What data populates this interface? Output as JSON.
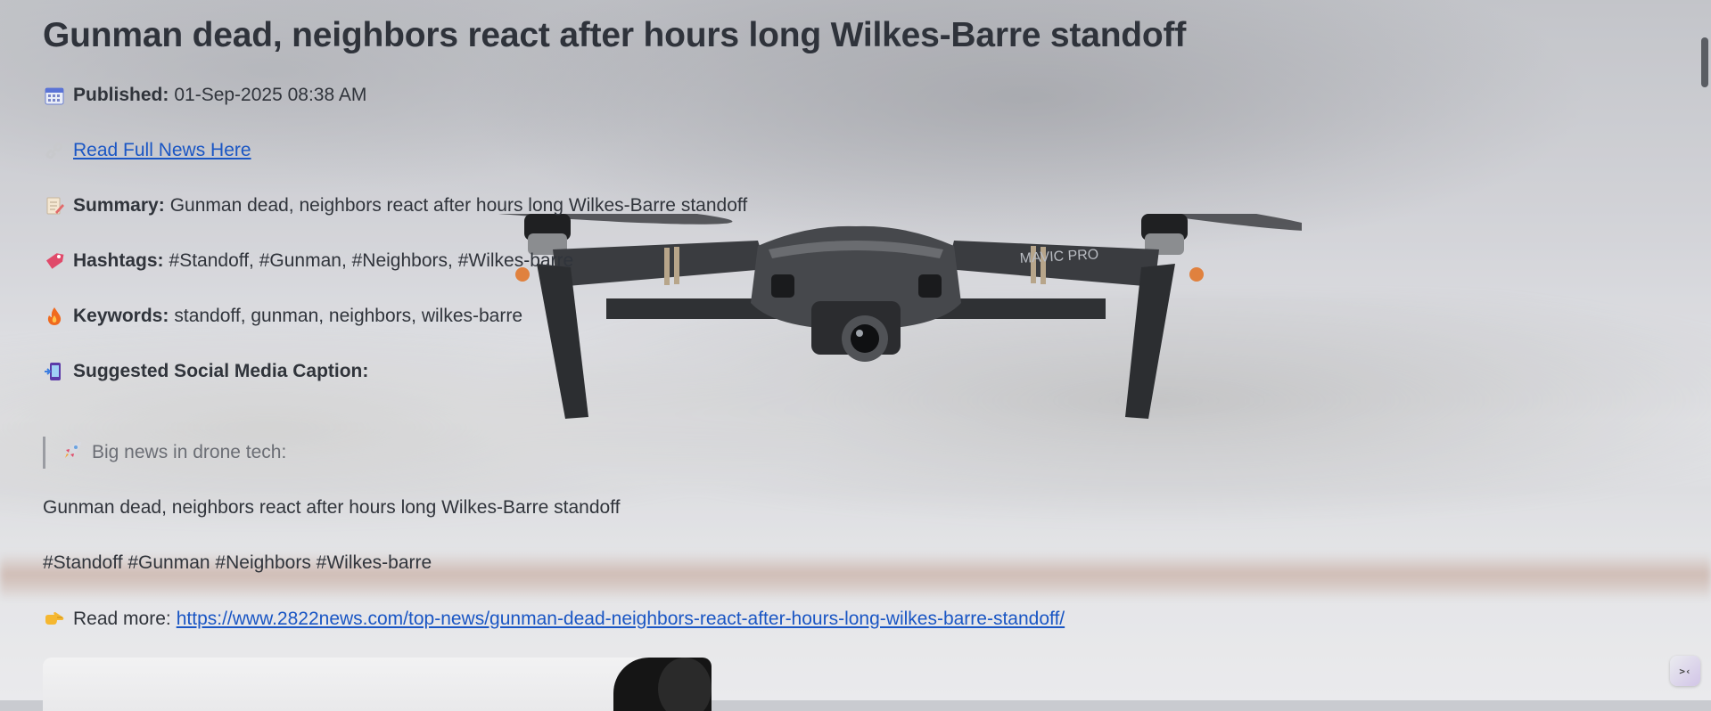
{
  "article": {
    "title": "Gunman dead, neighbors react after hours long Wilkes-Barre standoff",
    "published_label": "Published:",
    "published_value": "01-Sep-2025 08:38 AM",
    "read_full_link": "Read Full News Here",
    "summary_label": "Summary:",
    "summary_value": "Gunman dead, neighbors react after hours long Wilkes-Barre standoff",
    "hashtags_label": "Hashtags:",
    "hashtags_value": "#Standoff, #Gunman, #Neighbors, #Wilkes-barre",
    "keywords_label": "Keywords:",
    "keywords_value": "standoff, gunman, neighbors, wilkes-barre",
    "caption_label": "Suggested Social Media Caption:"
  },
  "caption": {
    "quote": "Big news in drone tech:",
    "headline": "Gunman dead, neighbors react after hours long Wilkes-Barre standoff",
    "hashtags": "#Standoff #Gunman #Neighbors #Wilkes-barre",
    "read_more_label": "Read more:",
    "read_more_url": "https://www.2822news.com/top-news/gunman-dead-neighbors-react-after-hours-long-wilkes-barre-standoff/"
  },
  "icons": {
    "published": "calendar-icon",
    "link": "link-icon",
    "summary": "memo-icon",
    "hashtags": "tag-icon",
    "keywords": "fire-icon",
    "caption": "mobile-phone-icon",
    "quote": "rocket-icon",
    "read_more": "pointing-hand-icon"
  },
  "drone_brand_text": "MAVIC PRO",
  "colors": {
    "link": "#1a56c4",
    "text": "#30343b",
    "quote_border": "#9a9ca2"
  }
}
